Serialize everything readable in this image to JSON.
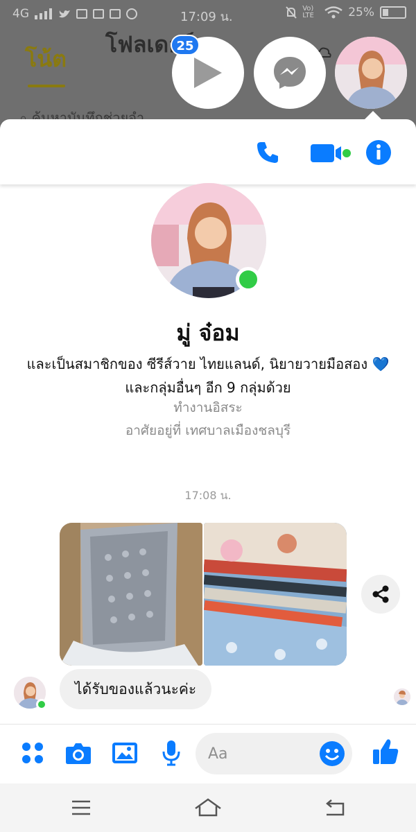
{
  "status_bar": {
    "network": "4G",
    "time": "17:09 น.",
    "volte_label": "Vo) LTE",
    "battery": "25%"
  },
  "background_app": {
    "tab_notes": "โน้ต",
    "tab_followers": "โฟลเดอร์",
    "search_placeholder": "ค้นหาบันทึกช่วยจำ"
  },
  "chat_heads": {
    "badge_count": "25",
    "items": [
      "video-play",
      "messenger",
      "profile"
    ]
  },
  "chat_header": {
    "icons": [
      "phone-icon",
      "video-call-icon",
      "info-icon"
    ],
    "accent": "#0a7cff",
    "online_color": "#31cc46"
  },
  "profile": {
    "name": "มู่ จ๋อม",
    "groups_text": "และเป็นสมาชิกของ ซีรีส์วาย ไทยแลนด์, นิยายวายมือสอง 💙 และกลุ่มอื่นๆ อีก 9 กลุ่มด้วย",
    "work": "ทำงานอิสระ",
    "location": "อาศัยอยู่ที่ เทศบาลเมืองชลบุรี"
  },
  "conversation": {
    "timestamp": "17:08 น.",
    "photos": [
      "parcel-photo",
      "books-photo"
    ],
    "message": "ได้รับของแล้วนะค่ะ"
  },
  "composer": {
    "placeholder": "Aa",
    "value": ""
  },
  "nav": {
    "icons": [
      "menu-icon",
      "home-icon",
      "back-icon"
    ]
  }
}
